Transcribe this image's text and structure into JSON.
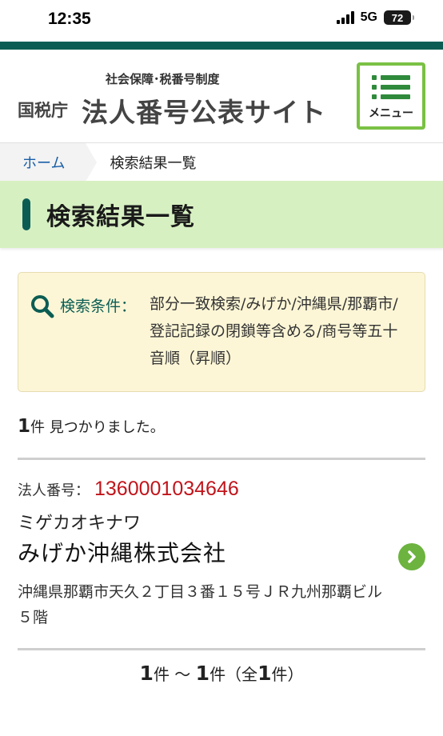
{
  "status": {
    "time": "12:35",
    "network": "5G",
    "battery": "72"
  },
  "header": {
    "subtitle": "社会保障･税番号制度",
    "agency": "国税庁",
    "title": "法人番号公表サイト",
    "menu_label": "メニュー"
  },
  "breadcrumb": {
    "home": "ホーム",
    "current": "検索結果一覧"
  },
  "page_title": "検索結果一覧",
  "search_condition": {
    "label": "検索条件：",
    "value": "部分一致検索/みげか/沖縄県/那覇市/登記記録の閉鎖等含める/商号等五十音順（昇順）"
  },
  "result_summary": {
    "count": "1",
    "suffix": "件 見つかりました。"
  },
  "results": [
    {
      "number_label": "法人番号：",
      "corporate_number": "1360001034646",
      "name_kana": "ミゲカオキナワ",
      "name": "みげか沖縄株式会社",
      "address": "沖縄県那覇市天久２丁目３番１５号ＪＲ九州那覇ビル５階"
    }
  ],
  "pagination": {
    "from": "1",
    "from_unit": "件",
    "tilde": " ～ ",
    "to": "1",
    "to_unit": "件（全",
    "total": "1",
    "total_unit": "件）"
  },
  "colors": {
    "brand_dark_green": "#0b5d54",
    "menu_green": "#7ac143",
    "title_band": "#d7f0c2",
    "corporate_number_red": "#c0141b",
    "condition_bg": "#fcf6d6",
    "arrow_green": "#6cb33f"
  },
  "icons": {
    "search": "search-icon",
    "menu": "menu-icon",
    "detail": "chevron-right-icon"
  }
}
